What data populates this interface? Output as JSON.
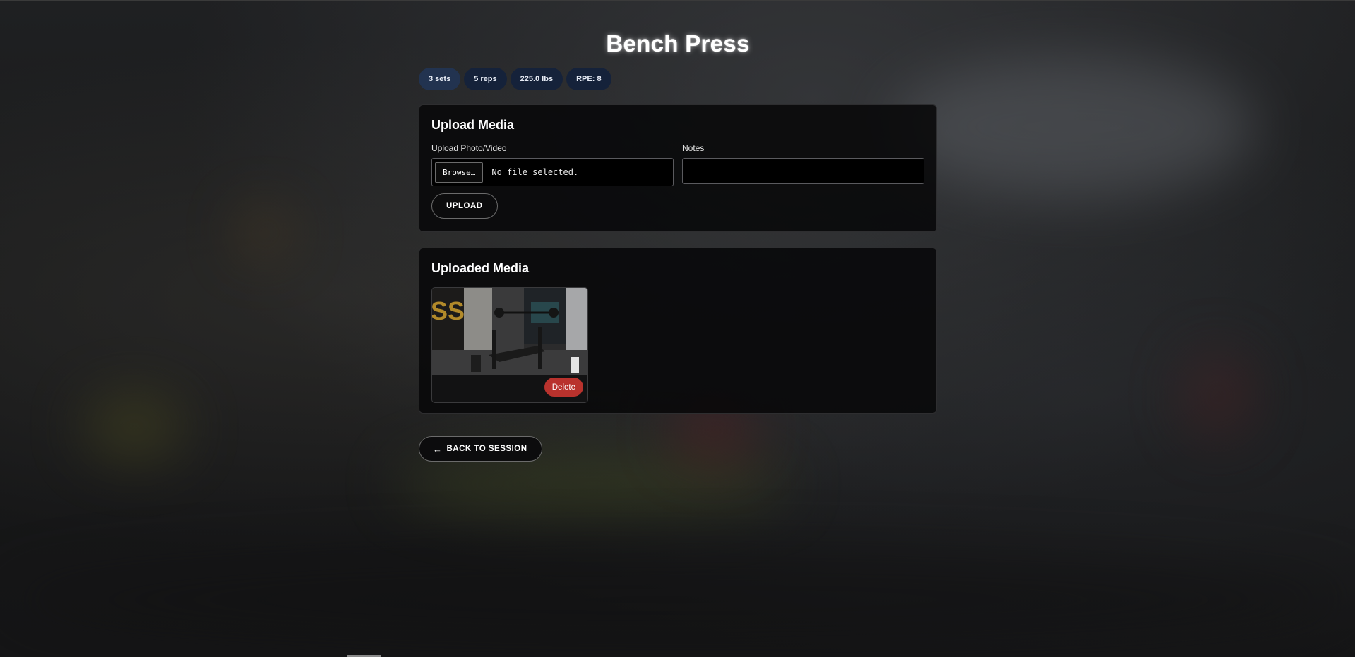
{
  "page": {
    "title": "Bench Press"
  },
  "badges": [
    {
      "label": "3 sets"
    },
    {
      "label": "5 reps"
    },
    {
      "label": "225.0 lbs"
    },
    {
      "label": "RPE: 8"
    }
  ],
  "upload_section": {
    "heading": "Upload Media",
    "file_label": "Upload Photo/Video",
    "browse_label": "Browse…",
    "file_status": "No file selected.",
    "notes_label": "Notes",
    "notes_value": "",
    "upload_button": "UPLOAD"
  },
  "media_section": {
    "heading": "Uploaded Media",
    "items": [
      {
        "thumbnail": "gym-bench-photo",
        "delete_label": "Delete"
      }
    ]
  },
  "back_button": {
    "label": "BACK TO SESSION",
    "icon": "arrow-left-icon"
  },
  "colors": {
    "badge_bg": "#15223a",
    "badge_active_bg": "#223350",
    "delete_red": "#b9322d",
    "card_bg": "#080809"
  }
}
